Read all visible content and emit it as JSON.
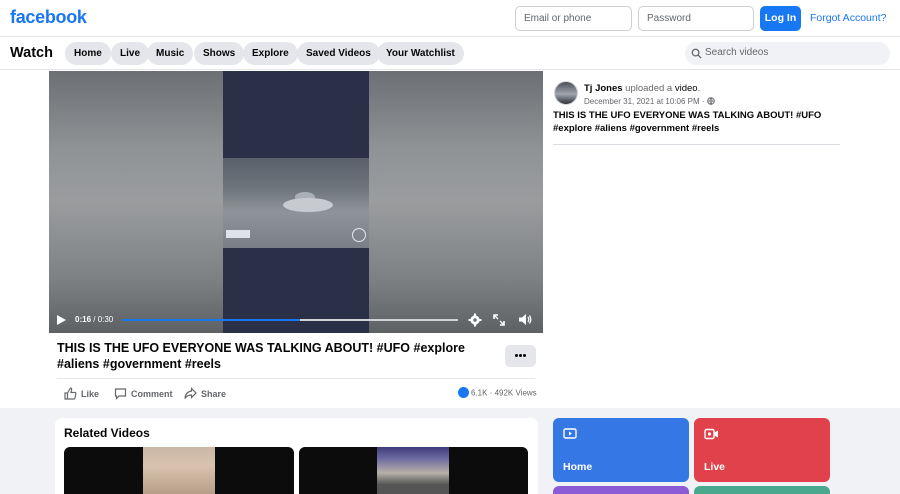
{
  "header": {
    "logo": "facebook",
    "email_placeholder": "Email or phone",
    "password_placeholder": "Password",
    "login_label": "Log In",
    "forgot_label": "Forgot Account?"
  },
  "watchbar": {
    "title": "Watch",
    "tabs": [
      {
        "label": "Home"
      },
      {
        "label": "Live"
      },
      {
        "label": "Music"
      },
      {
        "label": "Shows"
      },
      {
        "label": "Explore"
      },
      {
        "label": "Saved Videos"
      },
      {
        "label": "Your Watchlist"
      }
    ],
    "search_placeholder": "Search videos"
  },
  "player": {
    "current_time": "0:16",
    "separator": " / ",
    "total_time": "0:30",
    "progress": 0.53
  },
  "video": {
    "title": "THIS IS THE UFO EVERYONE WAS TALKING ABOUT! #UFO #explore #aliens #government #reels",
    "actions": {
      "like": "Like",
      "comment": "Comment",
      "share": "Share"
    },
    "reactions": "6.1K",
    "stats_sep": " · ",
    "views": "492K Views"
  },
  "post": {
    "author": "Tj Jones",
    "action_text": " uploaded a ",
    "object": "video",
    "period": ".",
    "date": "December 31, 2021 at 10:06 PM",
    "date_sep": " · ",
    "description": "THIS IS THE UFO EVERYONE WAS TALKING ABOUT! #UFO #explore #aliens #government #reels"
  },
  "related": {
    "title": "Related Videos"
  },
  "tiles": [
    {
      "label": "Home",
      "color": "#3578e5"
    },
    {
      "label": "Live",
      "color": "#e0414a"
    }
  ],
  "colors": {
    "brand": "#1877f2"
  }
}
